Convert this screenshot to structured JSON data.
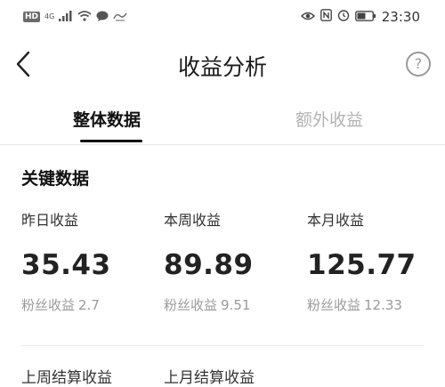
{
  "status_bar": {
    "left_tag": "HD",
    "network": "4G",
    "time": "23:30",
    "icons": [
      "signal-icon",
      "wifi-icon",
      "message-icon",
      "app-icon",
      "eye-icon",
      "nfc-icon",
      "alarm-icon",
      "battery-icon"
    ]
  },
  "appbar": {
    "title": "收益分析",
    "help": "?"
  },
  "tabs": [
    {
      "label": "整体数据",
      "active": true
    },
    {
      "label": "额外收益",
      "active": false
    }
  ],
  "section": {
    "title": "关键数据"
  },
  "metrics": [
    {
      "label": "昨日收益",
      "value": "35.43",
      "sub_label": "粉丝收益",
      "sub_value": "2.7"
    },
    {
      "label": "本周收益",
      "value": "89.89",
      "sub_label": "粉丝收益",
      "sub_value": "9.51"
    },
    {
      "label": "本月收益",
      "value": "125.77",
      "sub_label": "粉丝收益",
      "sub_value": "12.33"
    }
  ],
  "partial_row": [
    "上周结算收益",
    "上月结算收益"
  ]
}
